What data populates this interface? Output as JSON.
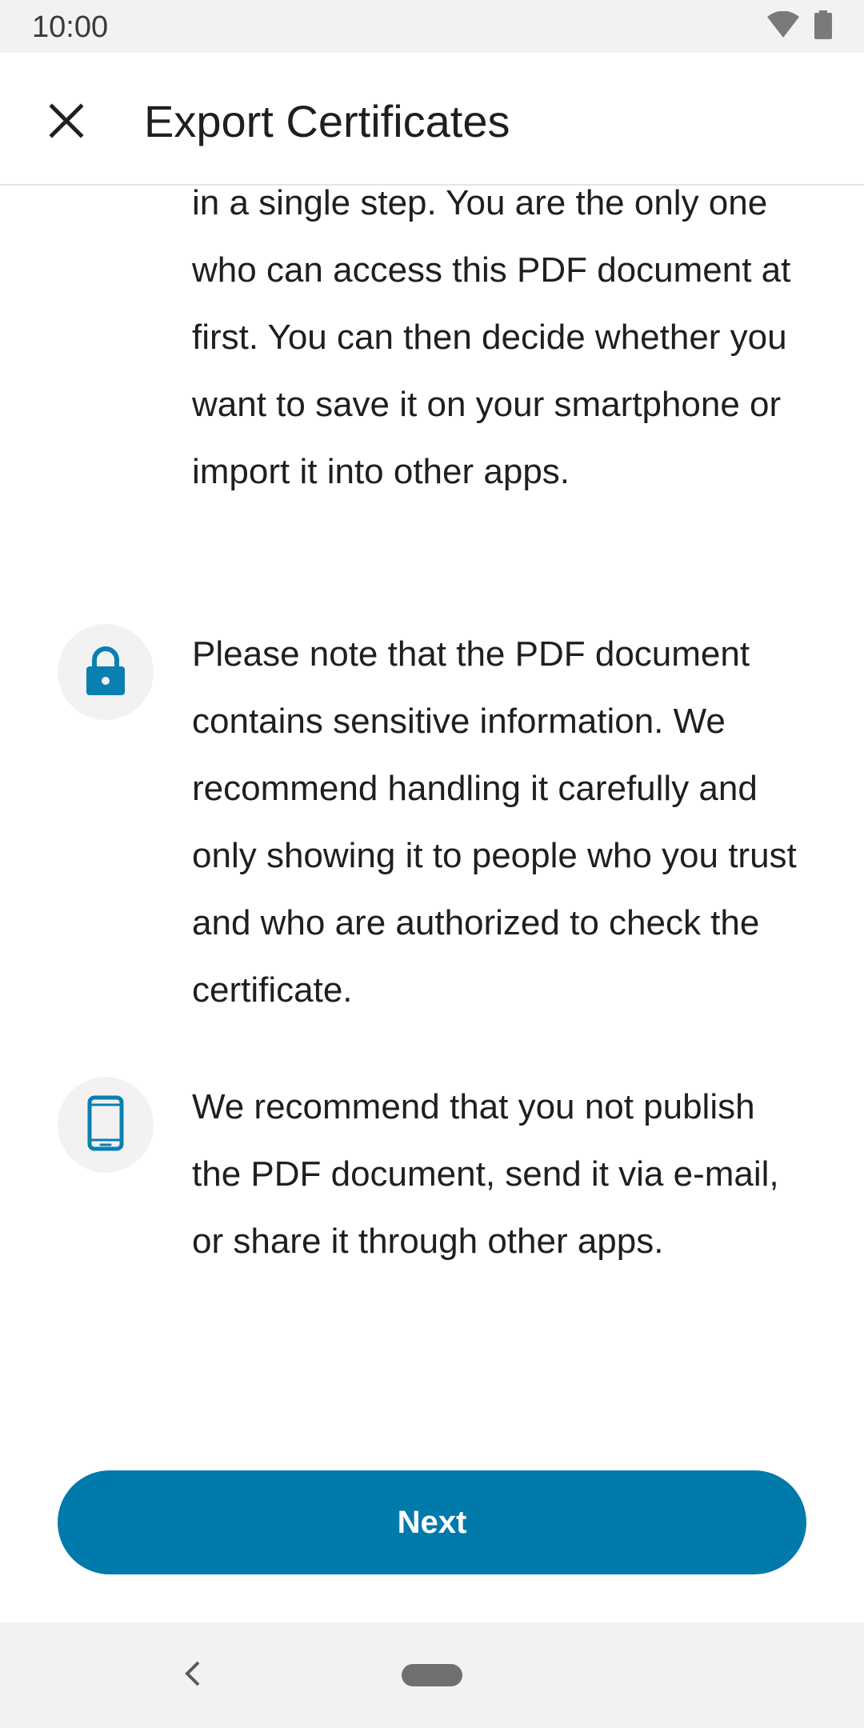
{
  "status_bar": {
    "time": "10:00",
    "icons": [
      "wifi-icon",
      "battery-icon"
    ]
  },
  "app_bar": {
    "close_icon": "close-icon",
    "title": "Export Certificates"
  },
  "content": {
    "intro_text": "in a single step. You are the only one who can access this PDF document at first. You can then decide whether you want to save it on your smartphone or import it into other apps.",
    "items": [
      {
        "icon": "lock-icon",
        "text": "Please note that the PDF document contains sensitive information. We recommend handling it carefully and only showing it to people who you trust and who are authorized to check the certificate."
      },
      {
        "icon": "smartphone-icon",
        "text": "We recommend that you not publish the PDF document, send it via e-mail, or share it through other apps."
      }
    ]
  },
  "actions": {
    "next_label": "Next"
  },
  "nav_bar": {
    "back_icon": "back-chevron-icon",
    "home_icon": "home-pill-icon"
  },
  "colors": {
    "accent": "#007aab",
    "icon_bg": "#f2f2f2",
    "text": "#1f1f1f"
  }
}
